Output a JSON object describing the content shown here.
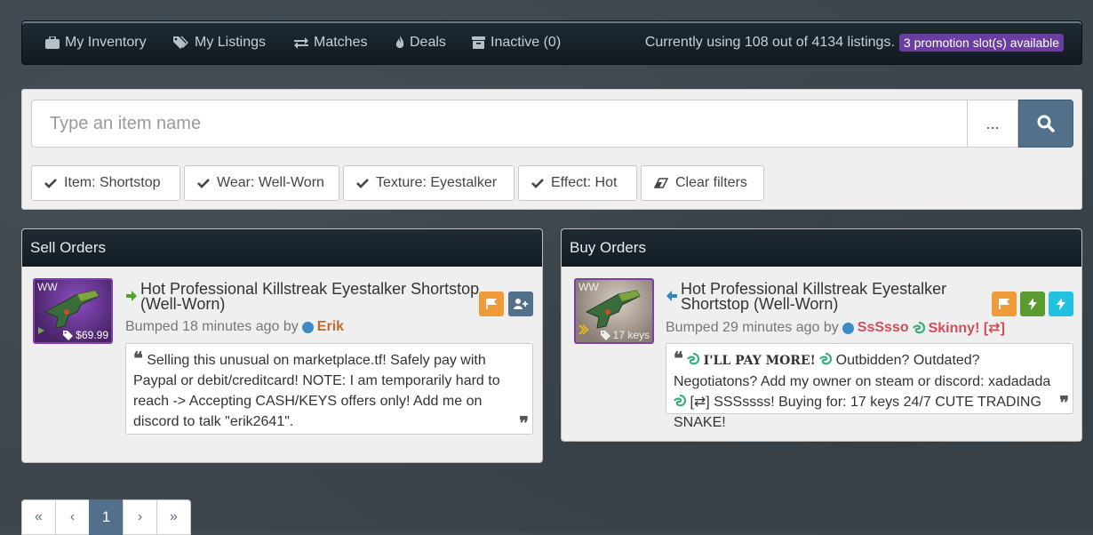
{
  "nav": {
    "items": [
      {
        "label": "My Inventory",
        "icon": "briefcase-icon"
      },
      {
        "label": "My Listings",
        "icon": "tags-icon"
      },
      {
        "label": "Matches",
        "icon": "exchange-icon"
      },
      {
        "label": "Deals",
        "icon": "fire-icon"
      },
      {
        "label": "Inactive (0)",
        "icon": "archive-icon"
      }
    ],
    "listings_text": "Currently using 108 out of 4134 listings.",
    "promo_text": "3 promotion slot(s) available"
  },
  "search": {
    "placeholder": "Type an item name",
    "dots_label": "..."
  },
  "filters": [
    {
      "label": "Item: Shortstop"
    },
    {
      "label": "Wear: Well-Worn"
    },
    {
      "label": "Texture: Eyestalker"
    },
    {
      "label": "Effect: Hot"
    },
    {
      "label": "Clear filters"
    }
  ],
  "sell": {
    "header": "Sell Orders",
    "wear": "WW",
    "price": "$69.99",
    "title_line1": "Hot Professional Killstreak Eyestalker Shortstop",
    "title_line2": "(Well-Worn)",
    "bumped": "Bumped 18 minutes ago by",
    "user": "Erik",
    "message": "Selling this unusual on marketplace.tf! Safely pay with Paypal or debit/creditcard! NOTE: I am temporarily hard to reach -> Accepting CASH/KEYS offers only! Add me on discord to talk \"erik2641\"."
  },
  "buy": {
    "header": "Buy Orders",
    "wear": "WW",
    "price": "17 keys",
    "title_line1": "Hot Professional Killstreak Eyestalker",
    "title_line2": "Shortstop (Well-Worn)",
    "bumped": "Bumped 29 minutes ago by",
    "user": "SsSsso",
    "user2": "Skinny! [⇄]",
    "message_bold": "I'LL PAY MORE!",
    "message_1": "Outbidden? Outdated? Negotiatons? Add my owner on steam or discord: xadadada",
    "message_2": "[⇄] SSSssss! Buying for: 17 keys 24/7 CUTE TRADING SNAKE!"
  },
  "pagination": {
    "first": "«",
    "prev": "‹",
    "current": "1",
    "next": "›",
    "last": "»"
  },
  "colors": {
    "accent": "#52708a",
    "promo": "#6a3ea1",
    "orange_btn": "#ef9b3a",
    "green_btn": "#5a9b2f",
    "cyan_btn": "#22c1e0",
    "steel_btn": "#52708a"
  }
}
